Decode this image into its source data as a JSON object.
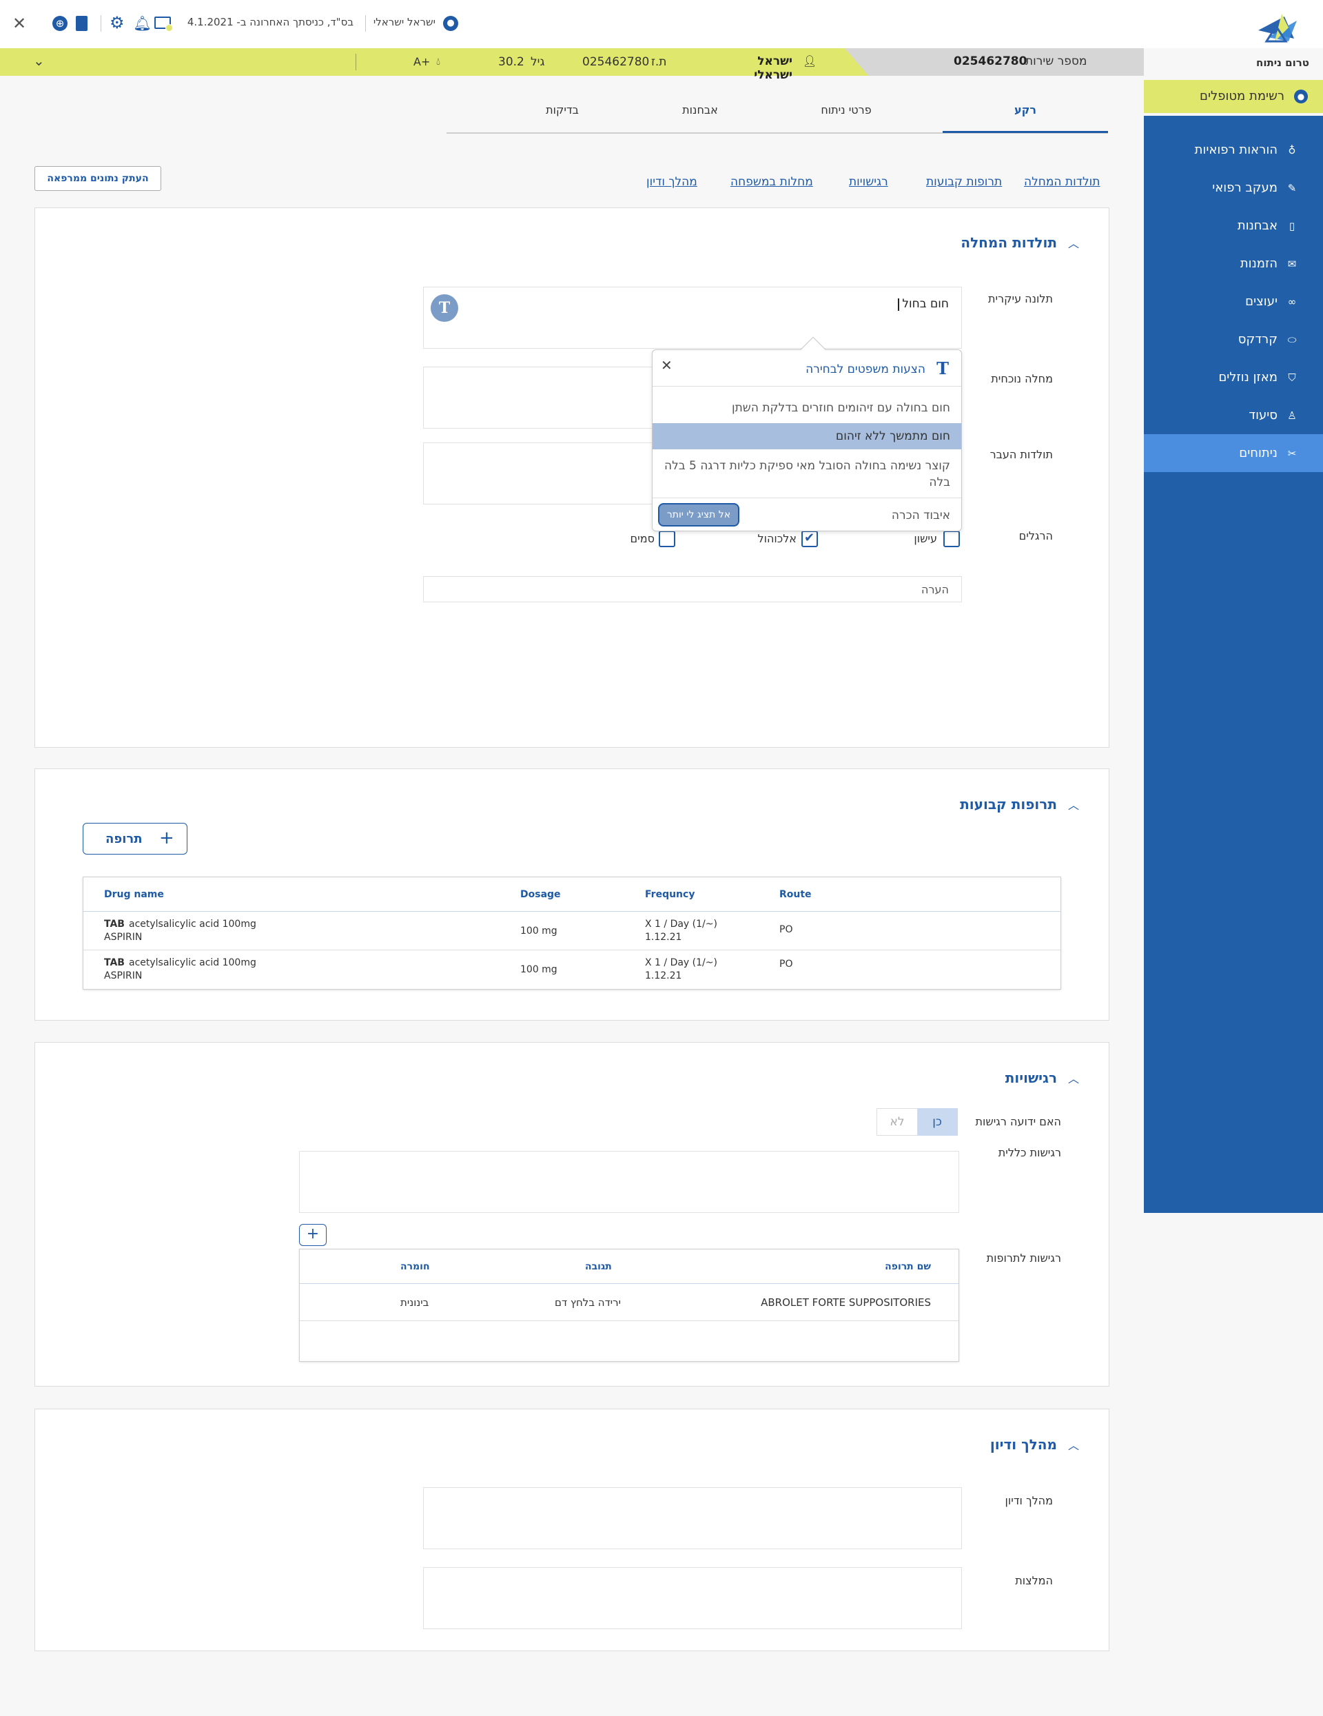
{
  "app": {
    "title": "טרום ניתוח"
  },
  "topbar": {
    "user_name": "ישראל ישראלי",
    "last_login": "בס\"ד, כניסתך האחרונה ב- 4.1.2021"
  },
  "patient": {
    "service_label": "מספר שירות",
    "service_number": "025462780",
    "name": "ישראל ישראלי",
    "id_label": "ת.ז",
    "id_number": "025462780",
    "age_label": "גיל",
    "age": "30.2",
    "blood_type": "A+"
  },
  "sidebar": {
    "patients_list": "רשימת מטופלים",
    "items": [
      {
        "label": "הוראות רפואיות",
        "icon": "stethoscope-icon"
      },
      {
        "label": "מעקב רפואי",
        "icon": "pencil-icon"
      },
      {
        "label": "אבחנות",
        "icon": "book-icon"
      },
      {
        "label": "הזמנות",
        "icon": "envelope-icon"
      },
      {
        "label": "יעוצים",
        "icon": "glasses-icon"
      },
      {
        "label": "קרדקס",
        "icon": "pill-icon"
      },
      {
        "label": "מאזן נוזלים",
        "icon": "drop-shield-icon"
      },
      {
        "label": "סיעוד",
        "icon": "nurse-icon"
      },
      {
        "label": "ניתוחים",
        "icon": "scissors-icon"
      }
    ],
    "active_index": 8
  },
  "tabs": [
    "רקע",
    "פרטי ניתוח",
    "אבחנות",
    "בדיקות"
  ],
  "active_tab": 0,
  "anchor_links": [
    "תולדות המחלה",
    "תרופות קבועות",
    "רגישויות",
    "מחלות במשפחה",
    "מהלך ודיון"
  ],
  "copy_button": "העתק נתונים ממרפאה",
  "history": {
    "title": "תולדות המחלה",
    "chief_complaint_label": "תלונה עיקרית",
    "chief_complaint_value": "חום בחול",
    "current_illness_label": "מחלה נוכחית",
    "past_history_label": "תולדות העבר",
    "habits_label": "הרגלים",
    "habits": [
      {
        "label": "עישון",
        "checked": false
      },
      {
        "label": "אלכוהול",
        "checked": true
      },
      {
        "label": "סמים",
        "checked": false
      }
    ],
    "note_placeholder": "הערה"
  },
  "suggestions": {
    "title": "הצעות משפטים לבחירה",
    "items": [
      "חום בחולה עם זיהומים חוזרים בדלקת השתן",
      "חום מתמשך ללא זיהום",
      "קוצר נשימה בחולה הסובל מאי ספיקת כליות דרגה 5 בלה בלה",
      "איבוד הכרה"
    ],
    "selected_index": 1,
    "dont_show_button": "אל תציג לי יותר"
  },
  "medications": {
    "title": "תרופות קבועות",
    "add_button": "תרופה",
    "columns": [
      "Drug name",
      "Dosage",
      "Frequncy",
      "Route"
    ],
    "rows": [
      {
        "form": "TAB",
        "name": "acetylsalicylic acid 100mg",
        "brand": "ASPIRIN",
        "dosage": "100 mg",
        "freq": "X 1 / Day (1/~)",
        "date": "1.12.21",
        "route": "PO"
      },
      {
        "form": "TAB",
        "name": "acetylsalicylic acid 100mg",
        "brand": "ASPIRIN",
        "dosage": "100 mg",
        "freq": "X 1 / Day (1/~)",
        "date": "1.12.21",
        "route": "PO"
      }
    ]
  },
  "allergies": {
    "title": "רגישויות",
    "known_label": "האם ידועה רגישות",
    "yes": "כן",
    "no": "לא",
    "general_label": "רגישות כללית",
    "drug_label": "רגישות לתרופות",
    "columns": [
      "שם תרופה",
      "תגובה",
      "חומרה"
    ],
    "rows": [
      {
        "drug": "ABROLET FORTE SUPPOSITORIES",
        "reaction": "ירידה בלחץ דם",
        "severity": "בינונית"
      }
    ]
  },
  "discussion": {
    "title": "מהלך ודיון",
    "course_label": "מהלך ודיון",
    "recommend_label": "המלצות"
  },
  "colors": {
    "primary": "#1f5aa6",
    "sidebar": "#2160a8",
    "accent": "#dfe76d",
    "active": "#4b8ee0"
  }
}
